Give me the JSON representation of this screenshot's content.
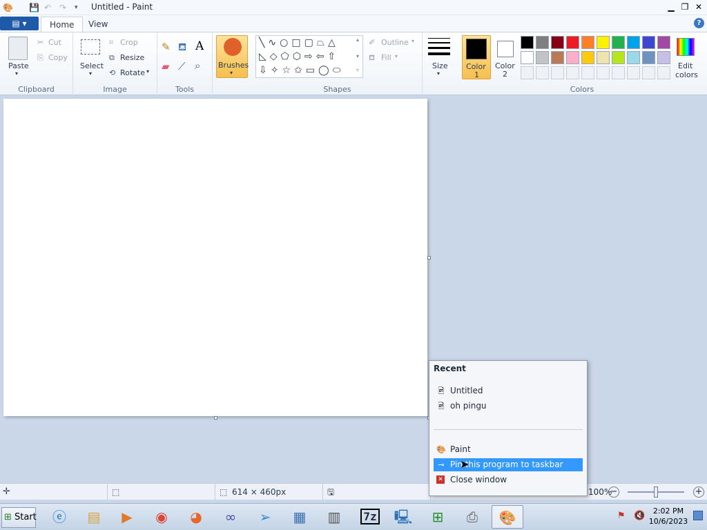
{
  "window": {
    "title": "Untitled - Paint"
  },
  "tabs": {
    "file": "▤ ▾",
    "home": "Home",
    "view": "View"
  },
  "clipboard": {
    "paste": "Paste",
    "cut": "Cut",
    "copy": "Copy",
    "group": "Clipboard"
  },
  "image": {
    "select": "Select",
    "crop": "Crop",
    "resize": "Resize",
    "rotate": "Rotate",
    "group": "Image"
  },
  "tools": {
    "group": "Tools"
  },
  "brushes": {
    "label": "Brushes"
  },
  "shapes": {
    "outline": "Outline",
    "fill": "Fill",
    "group": "Shapes"
  },
  "size": {
    "label": "Size"
  },
  "colors": {
    "color1": [
      "Color",
      "1"
    ],
    "color2": [
      "Color",
      "2"
    ],
    "edit": [
      "Edit",
      "colors"
    ],
    "group": "Colors",
    "active_color": "#000000",
    "palette_row1": [
      "#000000",
      "#7f7f7f",
      "#880015",
      "#ed1c24",
      "#ff7f27",
      "#fff200",
      "#22b14c",
      "#00a2e8",
      "#3f48cc",
      "#a349a4"
    ],
    "palette_row2": [
      "#ffffff",
      "#c3c3c3",
      "#b97a57",
      "#ffaec9",
      "#ffc90e",
      "#efe4b0",
      "#b5e61d",
      "#99d9ea",
      "#7092be",
      "#c8bfe7"
    ]
  },
  "status": {
    "dimensions": "614 × 460px",
    "zoom": "100%"
  },
  "jumplist": {
    "recent_header": "Recent",
    "recent": [
      "Untitled",
      "oh pingu"
    ],
    "program": "Paint",
    "pin": "Pin this program to taskbar",
    "close": "Close window"
  },
  "taskbar": {
    "start": "Start",
    "time": "2:02 PM",
    "date": "10/6/2023"
  }
}
